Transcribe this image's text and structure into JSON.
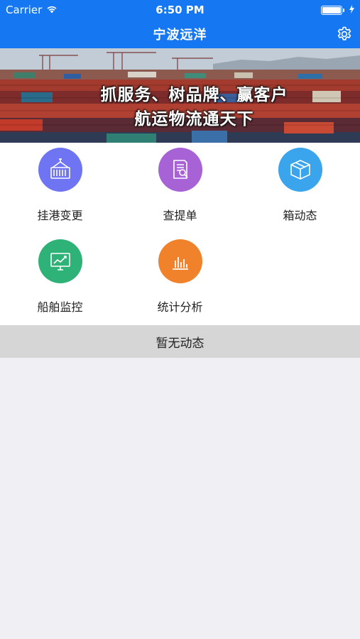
{
  "status_bar": {
    "carrier": "Carrier",
    "time": "6:50 PM"
  },
  "nav": {
    "title": "宁波远洋"
  },
  "banner": {
    "line1": "抓服务、树品牌、赢客户",
    "line2": "航运物流通天下"
  },
  "grid": [
    {
      "label": "挂港变更",
      "icon": "container-crane-icon",
      "color": "#6f74f2"
    },
    {
      "label": "查提单",
      "icon": "document-search-icon",
      "color": "#a763d6"
    },
    {
      "label": "箱动态",
      "icon": "box-icon",
      "color": "#3aa4ec"
    },
    {
      "label": "船舶监控",
      "icon": "monitor-chart-icon",
      "color": "#2fb277"
    },
    {
      "label": "统计分析",
      "icon": "bar-chart-icon",
      "color": "#f0822b"
    }
  ],
  "feed": {
    "empty_text": "暂无动态"
  },
  "colors": {
    "primary": "#1677f2",
    "band": "#d6d6d6",
    "background": "#efeff4"
  }
}
